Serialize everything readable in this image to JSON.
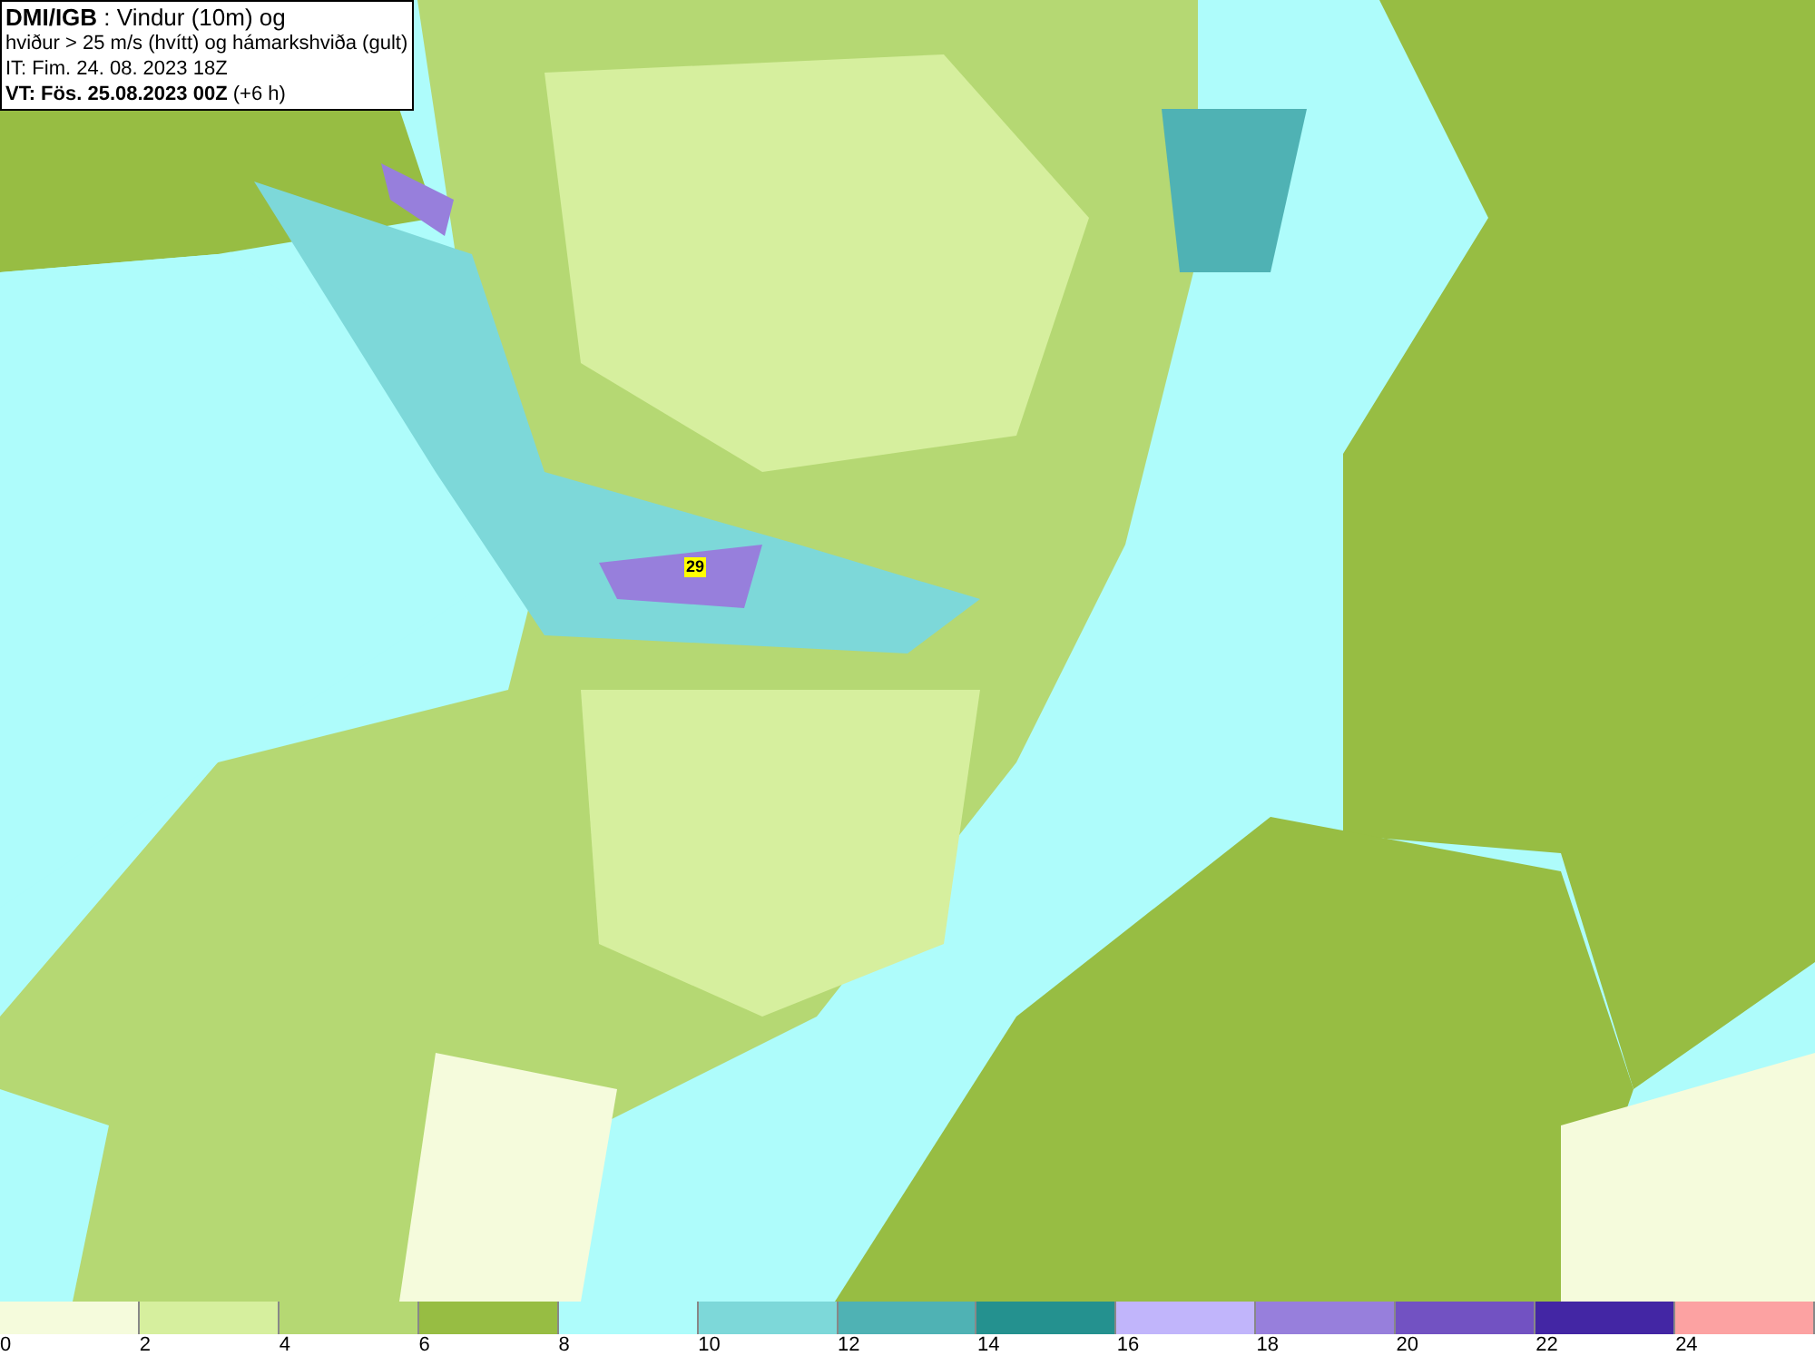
{
  "title_box": {
    "lines": [
      "**DMI/IGB** : Vindur (10m) og",
      "hviður > 25 m/s (hvítt) og hámarkshviða (gult)",
      "IT: Fim. 24. 08. 2023 18Z",
      "**VT: Fös. 25.08.2023 00Z** (+6 h)"
    ]
  },
  "map": {
    "max_gust_label": "29"
  },
  "legend": [
    {
      "label": "0",
      "color": "#f5fbdc"
    },
    {
      "label": "2",
      "color": "#d6ef9e"
    },
    {
      "label": "4",
      "color": "#b5d873"
    },
    {
      "label": "6",
      "color": "#97bd43"
    },
    {
      "label": "8",
      "color": "#aefcfb"
    },
    {
      "label": "10",
      "color": "#7dd8d9"
    },
    {
      "label": "12",
      "color": "#4fb2b4"
    },
    {
      "label": "14",
      "color": "#24918f"
    },
    {
      "label": "16",
      "color": "#c1b5fb"
    },
    {
      "label": "18",
      "color": "#977fdc"
    },
    {
      "label": "20",
      "color": "#7252c2"
    },
    {
      "label": "22",
      "color": "#4326a4"
    },
    {
      "label": "24",
      "color": "#fca2a2"
    }
  ]
}
